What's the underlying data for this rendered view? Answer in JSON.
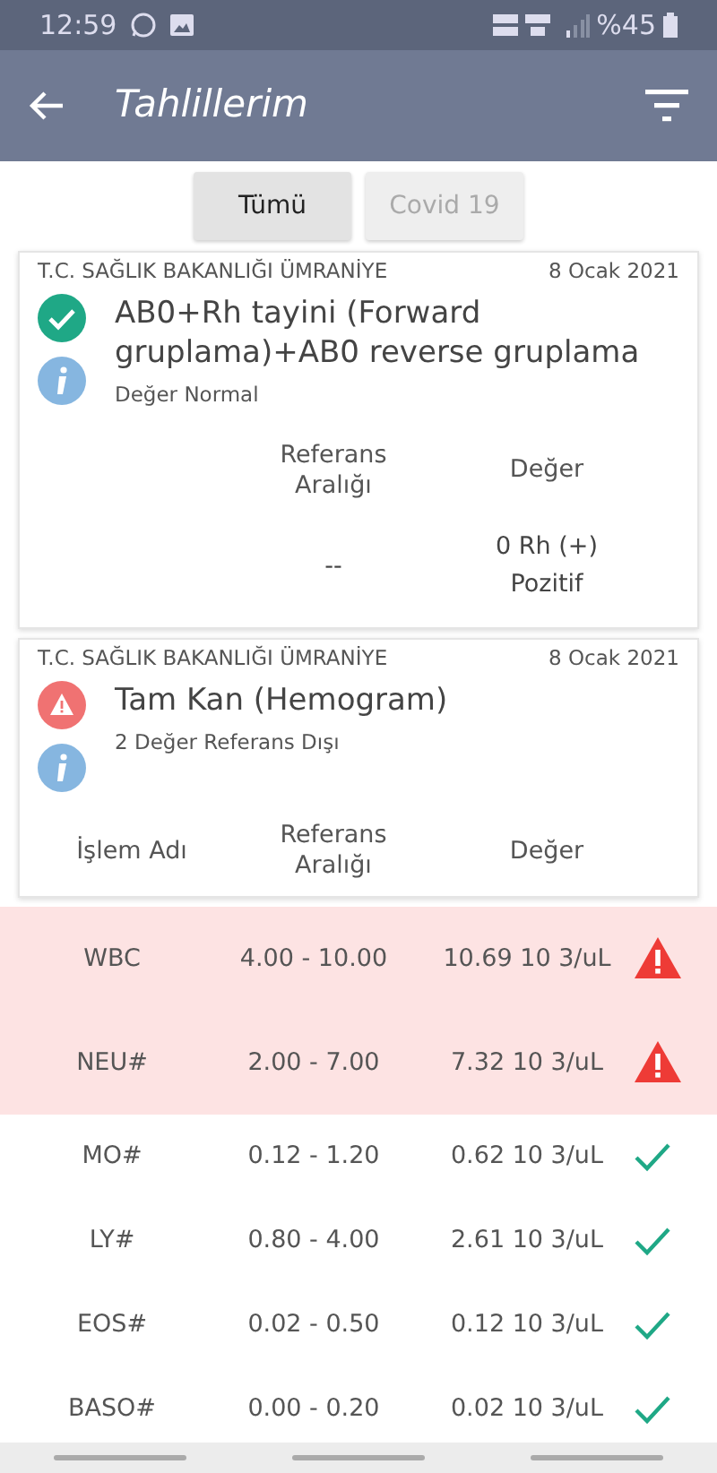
{
  "status_bar": {
    "time": "12:59",
    "battery_text": "%45"
  },
  "app_bar": {
    "title": "Tahlillerim"
  },
  "tabs": [
    {
      "label": "Tümü",
      "selected": true
    },
    {
      "label": "Covid 19",
      "selected": false
    }
  ],
  "tests": [
    {
      "institution": "T.C. SAĞLIK BAKANLIĞI ÜMRANİYE",
      "date": "8 Ocak 2021",
      "kind": "normal",
      "name": "AB0+Rh tayini  (Forward gruplama)+AB0 reverse gruplama",
      "summary": "Değer Normal",
      "columns": [
        "Referans Aralığı",
        "Değer"
      ],
      "results": [
        {
          "range": "--",
          "value": "0 Rh (+) Pozitif",
          "kind": "normal"
        }
      ]
    },
    {
      "institution": "T.C. SAĞLIK BAKANLIĞI ÜMRANİYE",
      "date": "8 Ocak 2021",
      "kind": "abnormal",
      "name": "Tam Kan (Hemogram)",
      "summary": "2 Değer Referans Dışı",
      "columns": [
        "İşlem Adı",
        "Referans Aralığı",
        "Değer"
      ],
      "results": [
        {
          "name": "WBC",
          "range": "4.00 - 10.00",
          "value": "10.69 10 3/uL",
          "kind": "high"
        },
        {
          "name": "NEU#",
          "range": "2.00 - 7.00",
          "value": "7.32 10 3/uL",
          "kind": "high"
        },
        {
          "name": "MO#",
          "range": "0.12 - 1.20",
          "value": "0.62 10 3/uL",
          "kind": "normal"
        },
        {
          "name": "LY#",
          "range": "0.80 - 4.00",
          "value": "2.61 10 3/uL",
          "kind": "normal"
        },
        {
          "name": "EOS#",
          "range": "0.02 - 0.50",
          "value": "0.12 10 3/uL",
          "kind": "normal"
        },
        {
          "name": "BASO#",
          "range": "0.00 - 0.20",
          "value": "0.02 10 3/uL",
          "kind": "normal"
        }
      ]
    }
  ]
}
